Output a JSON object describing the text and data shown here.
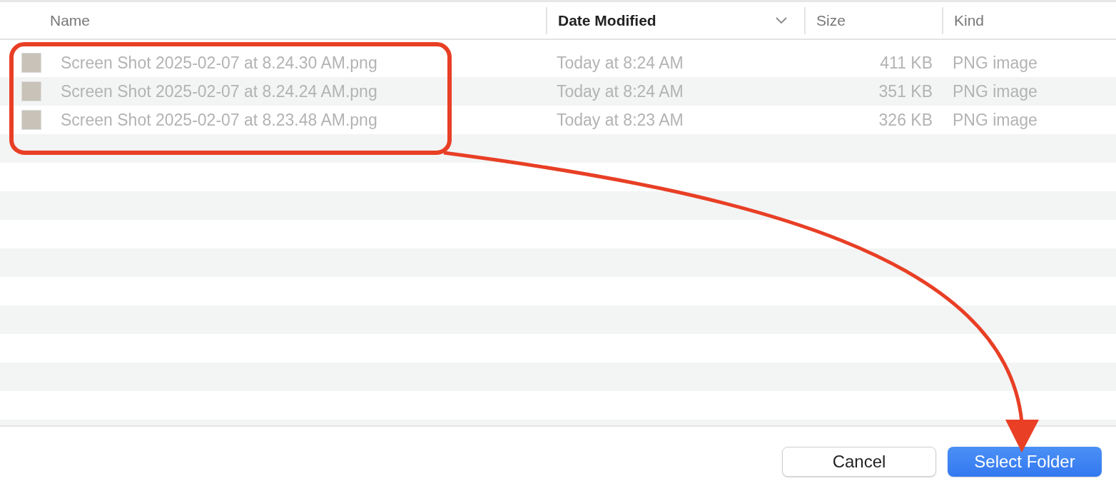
{
  "columns": [
    {
      "label": "Name",
      "sorted": false
    },
    {
      "label": "Date Modified",
      "sorted": true
    },
    {
      "label": "Size",
      "sorted": false
    },
    {
      "label": "Kind",
      "sorted": false
    }
  ],
  "files": [
    {
      "name": "Screen Shot 2025-02-07 at 8.24.30 AM.png",
      "date": "Today at 8:24 AM",
      "size": "411 KB",
      "kind": "PNG image",
      "disabled": true
    },
    {
      "name": "Screen Shot 2025-02-07 at 8.24.24 AM.png",
      "date": "Today at 8:24 AM",
      "size": "351 KB",
      "kind": "PNG image",
      "disabled": true
    },
    {
      "name": "Screen Shot 2025-02-07 at 8.23.48 AM.png",
      "date": "Today at 8:23 AM",
      "size": "326 KB",
      "kind": "PNG image",
      "disabled": true
    }
  ],
  "buttons": [
    {
      "label": "Cancel",
      "kind": "secondary"
    },
    {
      "label": "Select Folder",
      "kind": "primary"
    }
  ]
}
